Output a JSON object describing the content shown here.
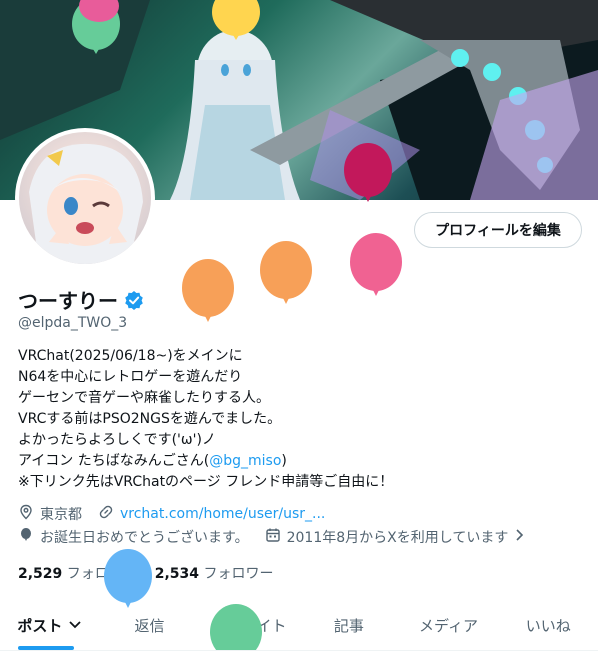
{
  "profile": {
    "display_name": "つーすりー",
    "handle": "@elpda_TWO_3",
    "edit_button": "プロフィールを編集",
    "bio": [
      "VRChat(2025/06/18~)をメインに",
      "N64を中心にレトロゲーを遊んだり",
      "ゲーセンで音ゲーや麻雀したりする人。",
      "VRCする前はPSO2NGSを遊んでました。",
      "よかったらよろしくです('ω')ノ",
      "アイコン たちばなみんごさん",
      "@bg_miso",
      ")",
      "※下リンク先はVRChatのページ フレンド申請等ご自由に！"
    ],
    "location": "東京都",
    "website": "vrchat.com/home/user/usr_...",
    "birthday": "お誕生日おめでとうございます。",
    "joined": "2011年8月からXを利用しています",
    "following_count": "2,529",
    "following_label": "フォロー中",
    "followers_count": "2,534",
    "followers_label": "フォロワー"
  },
  "tabs": [
    "ポスト",
    "返信",
    "ハイライト",
    "記事",
    "メディア",
    "いいね"
  ],
  "colors": {
    "accent": "#1d9bf0",
    "text": "#0f1419",
    "muted": "#536471",
    "balloon_orange": "#f7a058",
    "balloon_pink": "#f06292",
    "balloon_magenta": "#c2185b",
    "balloon_blue": "#64b5f6",
    "balloon_green": "#66cc99",
    "balloon_yellow": "#ffd54f"
  },
  "icons": [
    "location-icon",
    "link-icon",
    "balloon-icon",
    "calendar-icon",
    "verified-badge-icon",
    "chevron-down-icon",
    "chevron-right-icon"
  ]
}
